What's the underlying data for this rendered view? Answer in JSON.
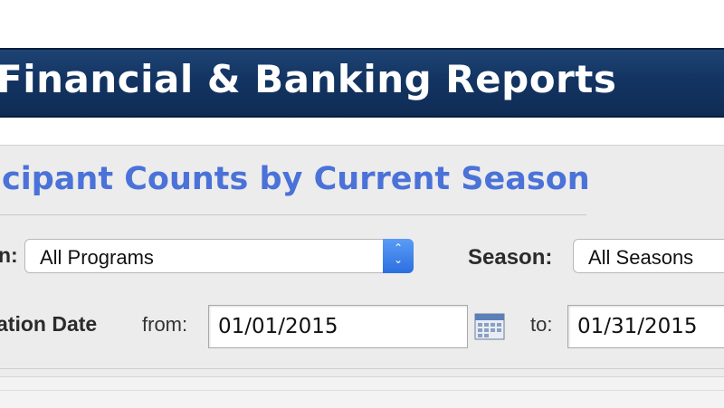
{
  "header": {
    "title": "Financial & Banking Reports"
  },
  "report": {
    "title": "icipant Counts by Current Season"
  },
  "filters": {
    "program_label": "n:",
    "program_value": "All Programs",
    "season_label": "Season:",
    "season_value": "All Seasons",
    "date_label": "ation Date",
    "from_label": "from:",
    "from_value": "01/01/2015",
    "to_label": "to:",
    "to_value": "01/31/2015"
  },
  "icons": {
    "select_arrows": "up-down-chevron-icon",
    "calendar": "calendar-icon"
  }
}
